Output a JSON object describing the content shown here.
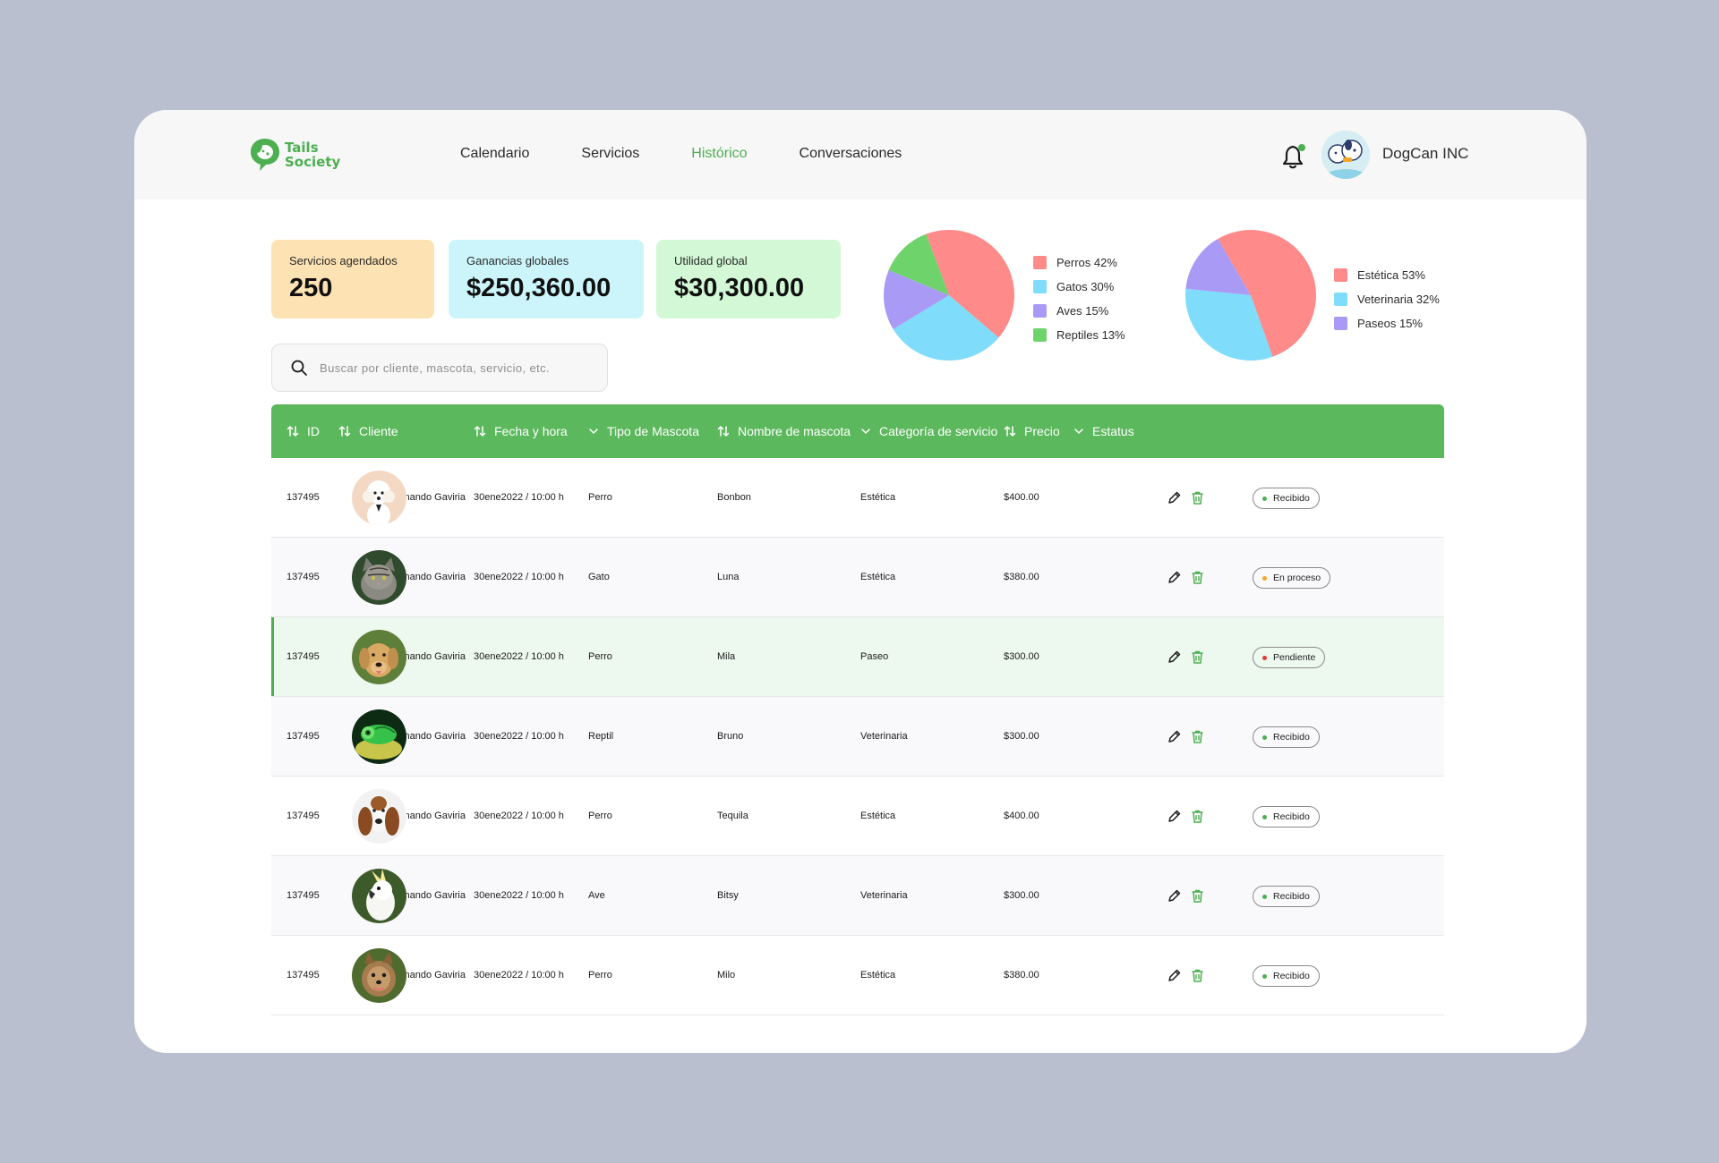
{
  "brand": {
    "line1": "Tails",
    "line2": "Society"
  },
  "nav": [
    {
      "label": "Calendario",
      "active": false
    },
    {
      "label": "Servicios",
      "active": false
    },
    {
      "label": "Histórico",
      "active": true
    },
    {
      "label": "Conversaciones",
      "active": false
    }
  ],
  "user": {
    "name": "DogCan INC",
    "notification_dot_color": "#4caf50"
  },
  "stats": [
    {
      "label": "Servicios agendados",
      "value": "250"
    },
    {
      "label": "Ganancias globales",
      "value": "$250,360.00"
    },
    {
      "label": "Utilidad global",
      "value": "$30,300.00"
    }
  ],
  "search": {
    "placeholder": "Buscar por cliente, mascota, servicio, etc.",
    "value": ""
  },
  "chart_data": [
    {
      "type": "pie",
      "categories": [
        "Perros",
        "Gatos",
        "Aves",
        "Reptiles"
      ],
      "values": [
        42,
        30,
        15,
        13
      ],
      "colors": [
        "#ff8a8a",
        "#7fdcfa",
        "#a99bf5",
        "#6fd36c"
      ],
      "legend": [
        "Perros 42%",
        "Gatos 30%",
        "Aves 15%",
        "Reptiles 13%"
      ],
      "legend_position": "right"
    },
    {
      "type": "pie",
      "categories": [
        "Estética",
        "Veterinaria",
        "Paseos"
      ],
      "values": [
        53,
        32,
        15
      ],
      "colors": [
        "#ff8a8a",
        "#7fdcfa",
        "#a99bf5"
      ],
      "legend": [
        "Estética 53%",
        "Veterinaria 32%",
        "Paseos 15%"
      ],
      "legend_position": "right"
    }
  ],
  "table": {
    "columns": [
      {
        "label": "ID",
        "icon": "sort-icon"
      },
      {
        "label": "Cliente",
        "icon": "sort-icon"
      },
      {
        "label": "Fecha y hora",
        "icon": "sort-icon"
      },
      {
        "label": "Tipo de Mascota",
        "icon": "chevron-down-icon"
      },
      {
        "label": "Nombre de mascota",
        "icon": "sort-icon"
      },
      {
        "label": "Categoría de servicio",
        "icon": "chevron-down-icon"
      },
      {
        "label": "Precio",
        "icon": "sort-icon"
      },
      {
        "label": "Estatus",
        "icon": "chevron-down-icon"
      }
    ],
    "status_colors": {
      "Recibido": "#4caf50",
      "En proceso": "#f5a623",
      "Pendiente": "#e53935"
    },
    "rows": [
      {
        "id": "137495",
        "client": "Fernando Gaviria",
        "date": "30ene2022 / 10:00 h",
        "type": "Perro",
        "pet": "Bonbon",
        "category": "Estética",
        "price": "$400.00",
        "status": "Recibido",
        "photo": "poodle-photo"
      },
      {
        "id": "137495",
        "client": "Fernando Gaviria",
        "date": "30ene2022 / 10:00 h",
        "type": "Gato",
        "pet": "Luna",
        "category": "Estética",
        "price": "$380.00",
        "status": "En proceso",
        "photo": "cat-photo"
      },
      {
        "id": "137495",
        "client": "Fernando Gaviria",
        "date": "30ene2022 / 10:00 h",
        "type": "Perro",
        "pet": "Mila",
        "category": "Paseo",
        "price": "$300.00",
        "status": "Pendiente",
        "photo": "labrador-photo"
      },
      {
        "id": "137495",
        "client": "Fernando Gaviria",
        "date": "30ene2022 / 10:00 h",
        "type": "Reptil",
        "pet": "Bruno",
        "category": "Veterinaria",
        "price": "$300.00",
        "status": "Recibido",
        "photo": "chameleon-photo"
      },
      {
        "id": "137495",
        "client": "Fernando Gaviria",
        "date": "30ene2022 / 10:00 h",
        "type": "Perro",
        "pet": "Tequila",
        "category": "Estética",
        "price": "$400.00",
        "status": "Recibido",
        "photo": "basset-photo"
      },
      {
        "id": "137495",
        "client": "Fernando Gaviria",
        "date": "30ene2022 / 10:00 h",
        "type": "Ave",
        "pet": "Bitsy",
        "category": "Veterinaria",
        "price": "$300.00",
        "status": "Recibido",
        "photo": "cockatoo-photo"
      },
      {
        "id": "137495",
        "client": "Fernando Gaviria",
        "date": "30ene2022 / 10:00 h",
        "type": "Perro",
        "pet": "Milo",
        "category": "Estética",
        "price": "$380.00",
        "status": "Recibido",
        "photo": "yorkie-photo"
      }
    ]
  }
}
